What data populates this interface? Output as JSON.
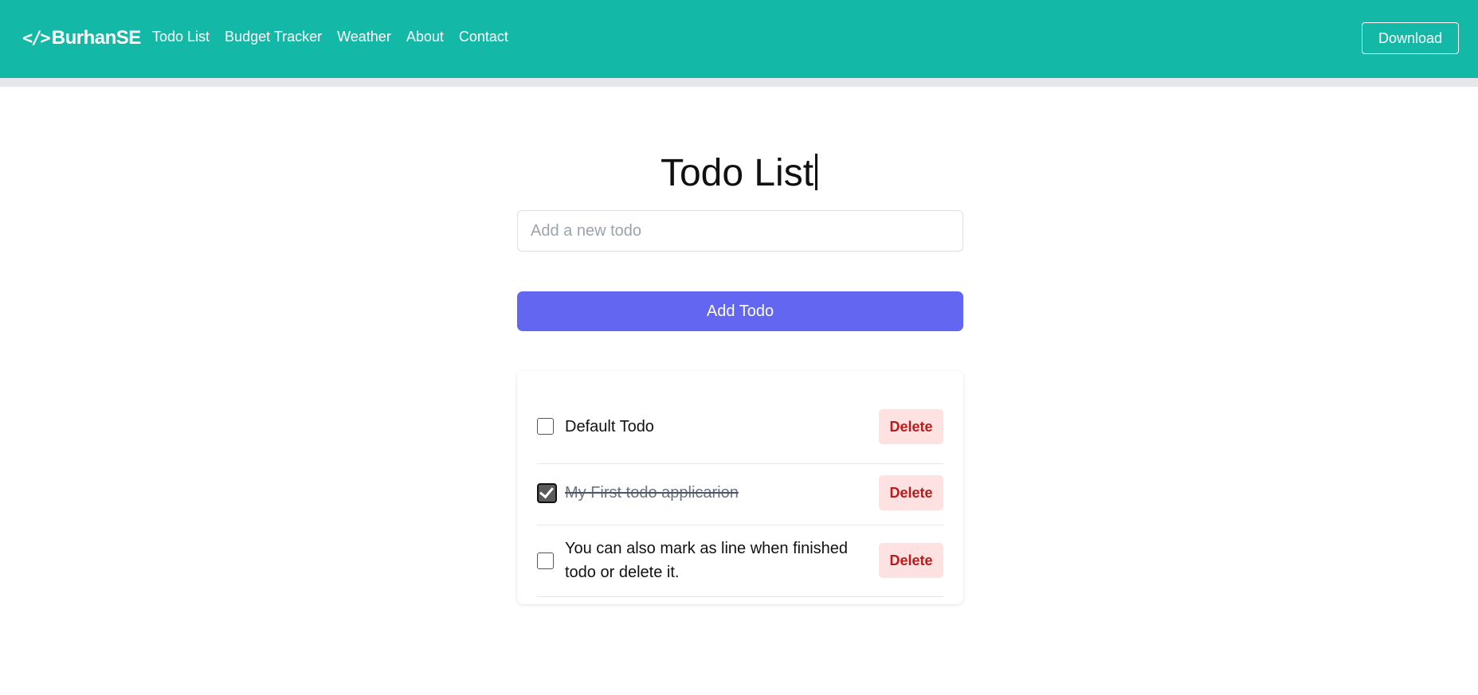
{
  "navbar": {
    "brand_icon": "code-brackets-icon",
    "brand_code_glyph": "</>",
    "brand": "BurhanSE",
    "links": [
      "Todo List",
      "Budget Tracker",
      "Weather",
      "About",
      "Contact"
    ],
    "download_label": "Download",
    "bg_color": "#14b8a6"
  },
  "main": {
    "title": "Todo List",
    "input_placeholder": "Add a new todo",
    "input_value": "",
    "add_button_label": "Add Todo",
    "accent_color": "#6366f1"
  },
  "todos": [
    {
      "text": "Default Todo",
      "completed": false,
      "delete_label": "Delete"
    },
    {
      "text": "My First todo applicarion",
      "completed": true,
      "delete_label": "Delete"
    },
    {
      "text_lines": [
        "You can also mark as line when finished",
        "todo or delete it."
      ],
      "completed": false,
      "delete_label": "Delete"
    }
  ]
}
